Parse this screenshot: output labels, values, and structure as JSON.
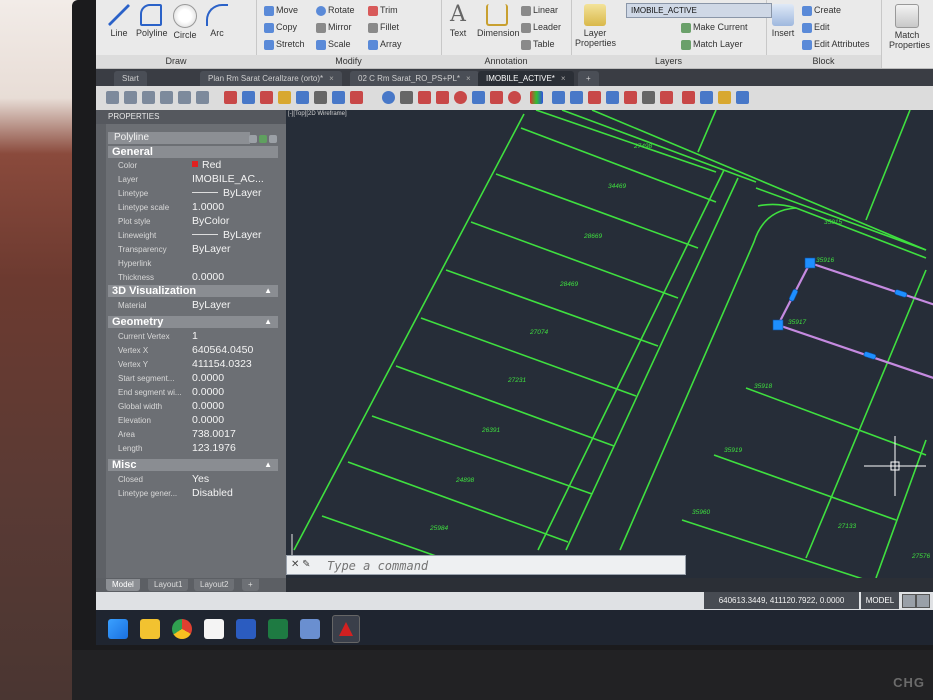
{
  "ribbon": {
    "draw": {
      "title": "Draw",
      "line": "Line",
      "polyline": "Polyline",
      "circle": "Circle",
      "arc": "Arc"
    },
    "modify": {
      "title": "Modify",
      "move": "Move",
      "rotate": "Rotate",
      "trim": "Trim",
      "copy": "Copy",
      "mirror": "Mirror",
      "fillet": "Fillet",
      "stretch": "Stretch",
      "scale": "Scale",
      "array": "Array"
    },
    "annotation": {
      "title": "Annotation",
      "text": "Text",
      "dimension": "Dimension",
      "linear": "Linear",
      "leader": "Leader",
      "table": "Table"
    },
    "layers": {
      "title": "Layers",
      "layer_properties": "Layer Properties",
      "current_layer": "IMOBILE_ACTIVE",
      "make_current": "Make Current",
      "match_layer": "Match Layer"
    },
    "block": {
      "title": "Block",
      "insert": "Insert",
      "create": "Create",
      "edit": "Edit",
      "edit_attributes": "Edit Attributes"
    },
    "properties": {
      "match_properties": "Match Properties"
    }
  },
  "tabs": [
    {
      "label": "Start",
      "active": false
    },
    {
      "label": "Plan Rm Sarat Cerallzare (orto)*",
      "active": false
    },
    {
      "label": "02 C Rm Sarat_RO_PS+PL*",
      "active": false
    },
    {
      "label": "IMOBILE_ACTIVE*",
      "active": true
    }
  ],
  "properties_panel": {
    "title": "PROPERTIES",
    "object_type": "Polyline",
    "sections": {
      "general": "General",
      "visualization": "3D Visualization",
      "geometry": "Geometry",
      "misc": "Misc"
    },
    "general": [
      {
        "key": "Color",
        "value": "Red"
      },
      {
        "key": "Layer",
        "value": "IMOBILE_AC..."
      },
      {
        "key": "Linetype",
        "value": "ByLayer"
      },
      {
        "key": "Linetype scale",
        "value": "1.0000"
      },
      {
        "key": "Plot style",
        "value": "ByColor"
      },
      {
        "key": "Lineweight",
        "value": "ByLayer"
      },
      {
        "key": "Transparency",
        "value": "ByLayer"
      },
      {
        "key": "Hyperlink",
        "value": ""
      },
      {
        "key": "Thickness",
        "value": "0.0000"
      }
    ],
    "visualization": [
      {
        "key": "Material",
        "value": "ByLayer"
      }
    ],
    "geometry": [
      {
        "key": "Current Vertex",
        "value": "1"
      },
      {
        "key": "Vertex X",
        "value": "640564.0450"
      },
      {
        "key": "Vertex Y",
        "value": "411154.0323"
      },
      {
        "key": "Start segment...",
        "value": "0.0000"
      },
      {
        "key": "End segment wi...",
        "value": "0.0000"
      },
      {
        "key": "Global width",
        "value": "0.0000"
      },
      {
        "key": "Elevation",
        "value": "0.0000"
      },
      {
        "key": "Area",
        "value": "738.0017"
      },
      {
        "key": "Length",
        "value": "123.1976"
      }
    ],
    "misc": [
      {
        "key": "Closed",
        "value": "Yes"
      },
      {
        "key": "Linetype gener...",
        "value": "Disabled"
      }
    ]
  },
  "drawing": {
    "view_label": "[-][Top][2D Wireframe]",
    "parcels": [
      "27498",
      "34469",
      "28669",
      "28469",
      "27074",
      "27231",
      "26391",
      "24898",
      "25984",
      "35915",
      "35916",
      "35917",
      "35918",
      "35919",
      "35960",
      "27133",
      "27576"
    ]
  },
  "command_line": {
    "placeholder": "Type a command"
  },
  "layout_tabs": [
    "Model",
    "Layout1",
    "Layout2"
  ],
  "status": {
    "coordinates": "640613.3449, 411120.7922, 0.0000",
    "mode": "MODEL"
  },
  "colors": {
    "parcel_line": "#3fe03f",
    "selection": "#c58ae0",
    "grip": "#1e8fff",
    "canvas": "#262d38"
  }
}
